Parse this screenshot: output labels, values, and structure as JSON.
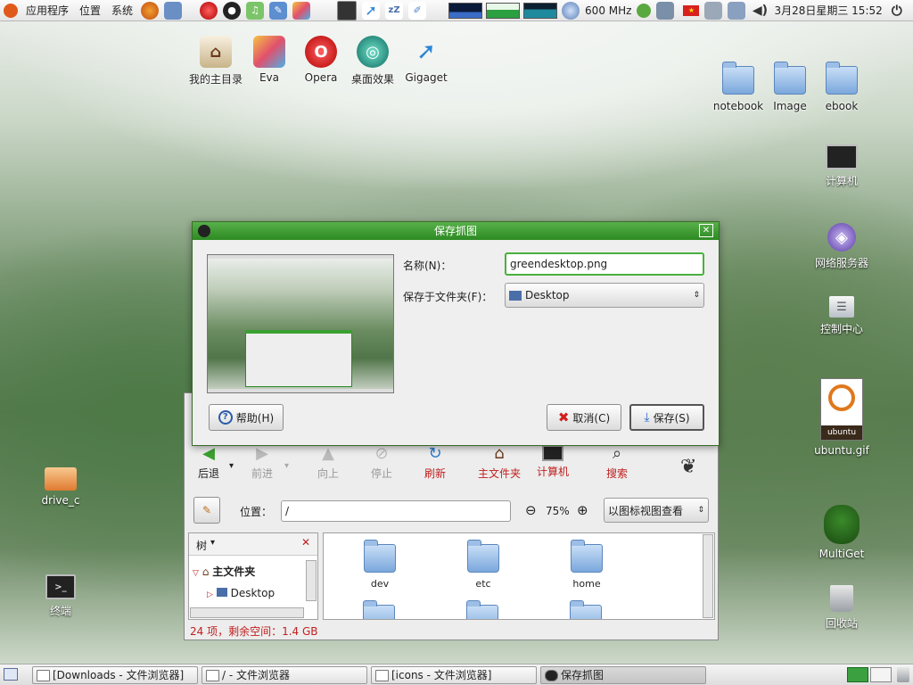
{
  "top_panel": {
    "menus": [
      "应用程序",
      "位置",
      "系统"
    ],
    "cpu_freq": "600 MHz",
    "datetime": "3月28日星期三 15:52"
  },
  "desktop_icons": {
    "home": "我的主目录",
    "eva": "Eva",
    "opera": "Opera",
    "effects": "桌面效果",
    "gigaget": "Gigaget",
    "notebook": "notebook",
    "image": "Image",
    "ebook": "ebook",
    "computer": "计算机",
    "network": "网络服务器",
    "control": "控制中心",
    "ubuntu_gif": "ubuntu.gif",
    "ubuntu_logo_text": "ubuntu",
    "multiget": "MultiGet",
    "trash": "回收站",
    "drive_c": "drive_c",
    "terminal": "终端"
  },
  "dialog": {
    "title": "保存抓图",
    "name_label": "名称(N)：",
    "name_value": "greendesktop.png",
    "folder_label": "保存于文件夹(F)：",
    "folder_value": "Desktop",
    "help_button": "帮助(H)",
    "cancel_button": "取消(C)",
    "save_button": "保存(S)"
  },
  "browser": {
    "toolbar": {
      "back": "后退",
      "forward": "前进",
      "up": "向上",
      "stop": "停止",
      "reload": "刷新",
      "home": "主文件夹",
      "computer": "计算机",
      "search": "搜索"
    },
    "location_label": "位置：",
    "location_value": "/",
    "zoom": "75%",
    "view_mode": "以图标视图查看",
    "sidebar_mode": "树",
    "tree": {
      "home": "主文件夹",
      "desktop": "Desktop"
    },
    "files": [
      "dev",
      "etc",
      "home"
    ],
    "status": "24 项，剩余空间：1.4 GB"
  },
  "taskbar": [
    "[Downloads - 文件浏览器]",
    "/ - 文件浏览器",
    "[icons - 文件浏览器]",
    "保存抓图"
  ]
}
